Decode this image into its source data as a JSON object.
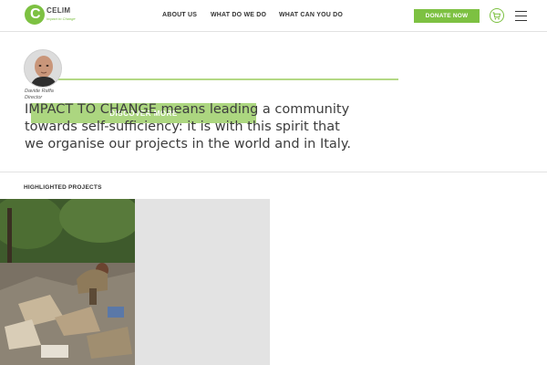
{
  "header": {
    "logo": {
      "name": "CELIM",
      "tagline": "Impact to Change"
    },
    "nav": [
      {
        "label": "ABOUT US"
      },
      {
        "label": "WHAT DO WE DO"
      },
      {
        "label": "WHAT CAN YOU DO"
      }
    ],
    "donate_label": "DONATE NOW",
    "icons": {
      "cart": "cart-icon",
      "menu": "hamburger-menu-icon"
    }
  },
  "hero": {
    "person_name": "Davide Raffa",
    "person_role": "Director",
    "discover_label": "DISCOVER MORE",
    "quote": "IMPACT TO CHANGE means leading a community towards self-sufficiency: it is with this spirit that we organise our projects in the world and in Italy."
  },
  "projects": {
    "section_title": "HIGHLIGHTED PROJECTS"
  },
  "colors": {
    "accent": "#7dc142",
    "accent_light": "#b4d985"
  }
}
